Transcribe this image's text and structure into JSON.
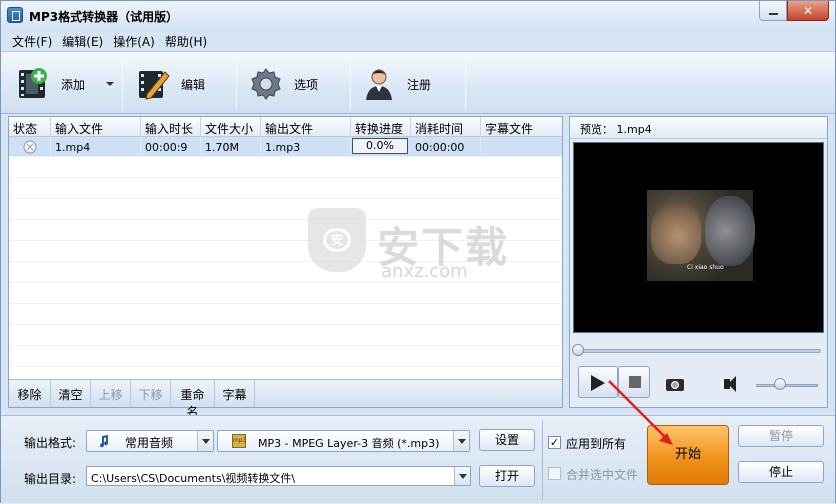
{
  "window": {
    "title": "MP3格式转换器（试用版）",
    "minimize": "_",
    "close": "✕"
  },
  "menu": [
    "文件(F)",
    "编辑(E)",
    "操作(A)",
    "帮助(H)"
  ],
  "toolbar": {
    "add": "添加",
    "edit": "编辑",
    "options": "选项",
    "register": "注册"
  },
  "table": {
    "headers": [
      "状态",
      "输入文件",
      "输入时长",
      "文件大小",
      "输出文件",
      "转换进度",
      "消耗时间",
      "字幕文件"
    ],
    "rows": [
      {
        "input_file": "1.mp4",
        "duration": "00:00:9",
        "size": "1.70M",
        "output_file": "1.mp3",
        "progress": "0.0%",
        "elapsed": "00:00:00",
        "subtitle": ""
      }
    ]
  },
  "list_actions": {
    "remove": "移除",
    "clear": "清空",
    "move_up": "上移",
    "move_down": "下移",
    "rename": "重命名",
    "subtitle": "字幕"
  },
  "watermark": {
    "text": "安下载",
    "sub": "anxz.com",
    "shield": "安"
  },
  "preview": {
    "label": "预览：  1.mp4",
    "video_subtitle": "Ci xiao shuo"
  },
  "bottom": {
    "format_label": "输出格式:",
    "category": "常用音频",
    "format": "MP3 - MPEG Layer-3 音频 (*.mp3)",
    "format_icon_text": "mp3",
    "settings": "设置",
    "dir_label": "输出目录:",
    "dir_value": "C:\\Users\\CS\\Documents\\视频转换文件\\",
    "open": "打开",
    "apply_all": "应用到所有",
    "merge": "合并选中文件",
    "start": "开始",
    "pause": "暂停",
    "stop": "停止"
  },
  "colors": {
    "accent": "#f0931c",
    "arrow": "#e02020"
  }
}
